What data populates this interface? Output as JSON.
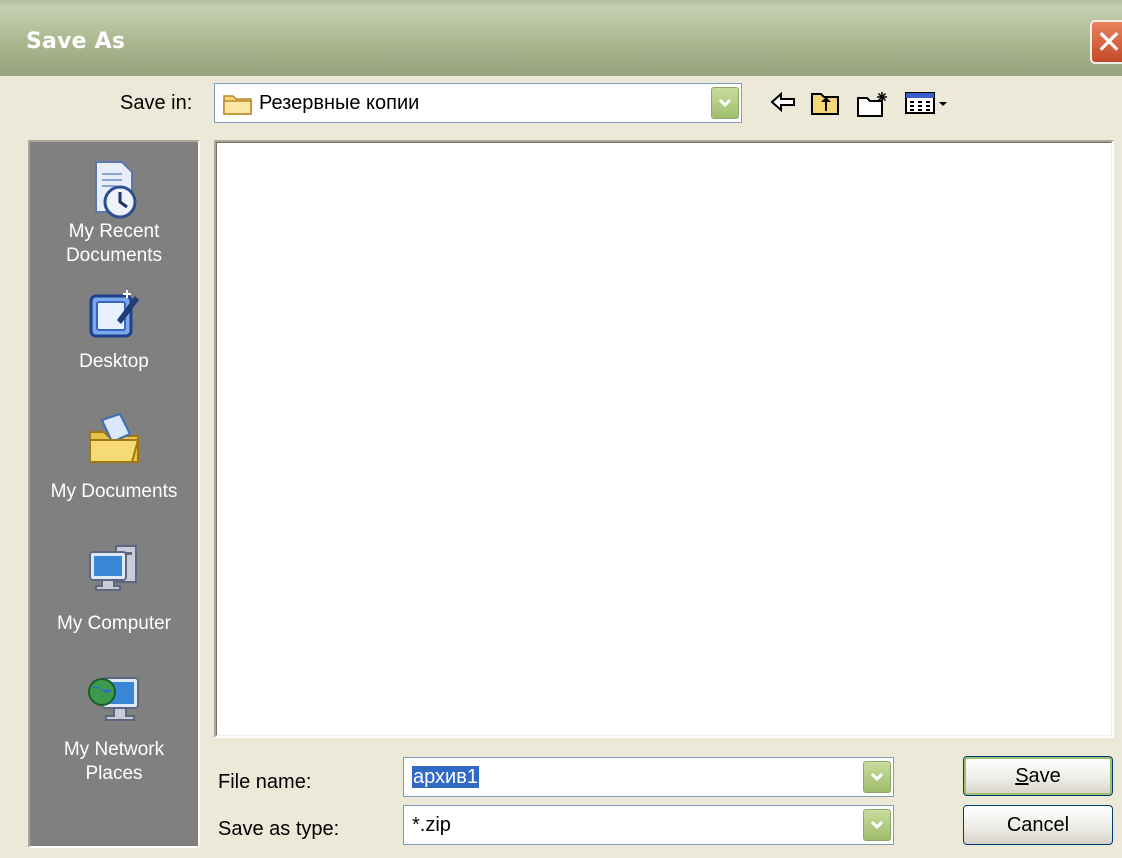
{
  "window": {
    "title": "Save As",
    "close_label": "✕"
  },
  "toolbar": {
    "save_in_label": "Save in:",
    "save_in_value": "Резервные копии",
    "back_icon": "back-arrow-icon",
    "up_icon": "up-one-level-icon",
    "new_folder_icon": "new-folder-icon",
    "views_icon": "views-menu-icon"
  },
  "places": [
    {
      "label_line1": "My Recent",
      "label_line2": "Documents",
      "icon": "recent-documents-icon"
    },
    {
      "label_line1": "Desktop",
      "label_line2": "",
      "icon": "desktop-icon"
    },
    {
      "label_line1": "My Documents",
      "label_line2": "",
      "icon": "my-documents-icon"
    },
    {
      "label_line1": "My Computer",
      "label_line2": "",
      "icon": "my-computer-icon"
    },
    {
      "label_line1": "My Network",
      "label_line2": "Places",
      "icon": "network-places-icon"
    }
  ],
  "form": {
    "file_name_label": "File name:",
    "file_name_value": "архив1",
    "save_as_type_label": "Save as type:",
    "save_as_type_value": "*.zip"
  },
  "buttons": {
    "save_label_accel": "S",
    "save_label_rest": "ave",
    "cancel_label": "Cancel"
  },
  "colors": {
    "title_bar": "#adb892",
    "places_bar": "#808080",
    "selection": "#316ac5"
  }
}
